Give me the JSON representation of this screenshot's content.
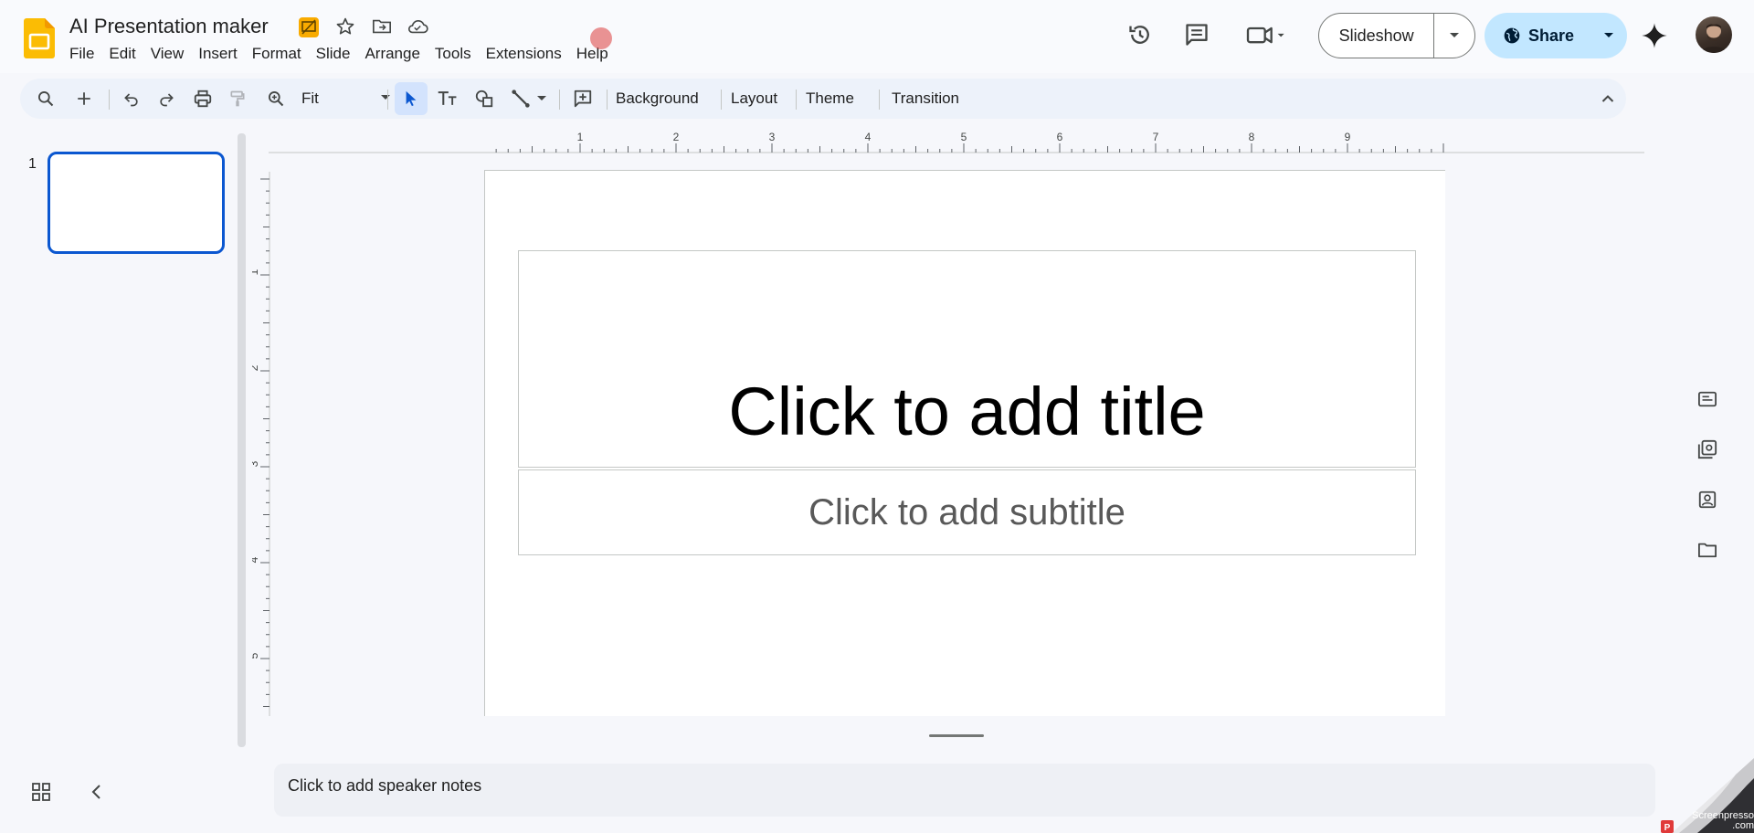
{
  "header": {
    "doc_title": "AI Presentation maker",
    "menu": [
      "File",
      "Edit",
      "View",
      "Insert",
      "Format",
      "Slide",
      "Arrange",
      "Tools",
      "Extensions",
      "Help"
    ],
    "slideshow_label": "Slideshow",
    "share_label": "Share",
    "brand_color": "#fbbc04",
    "share_bg": "#c2e7ff"
  },
  "toolbar": {
    "zoom_value": "Fit",
    "background_label": "Background",
    "layout_label": "Layout",
    "theme_label": "Theme",
    "transition_label": "Transition"
  },
  "filmstrip": {
    "slides": [
      {
        "number": "1"
      }
    ],
    "selection_color": "#0b57d0"
  },
  "ruler": {
    "h_labels": [
      "1",
      "2",
      "3",
      "4",
      "5",
      "6",
      "7",
      "8",
      "9"
    ],
    "v_labels": [
      "1",
      "2",
      "3",
      "4",
      "5"
    ]
  },
  "slide": {
    "title_placeholder": "Click to add title",
    "subtitle_placeholder": "Click to add subtitle"
  },
  "notes": {
    "placeholder": "Click to add speaker notes"
  },
  "side_panel": {
    "icons": [
      "keep-icon",
      "tasks-icon",
      "contacts-icon",
      "drive-icon"
    ]
  },
  "watermark": {
    "text": "Screenpresso .com"
  }
}
